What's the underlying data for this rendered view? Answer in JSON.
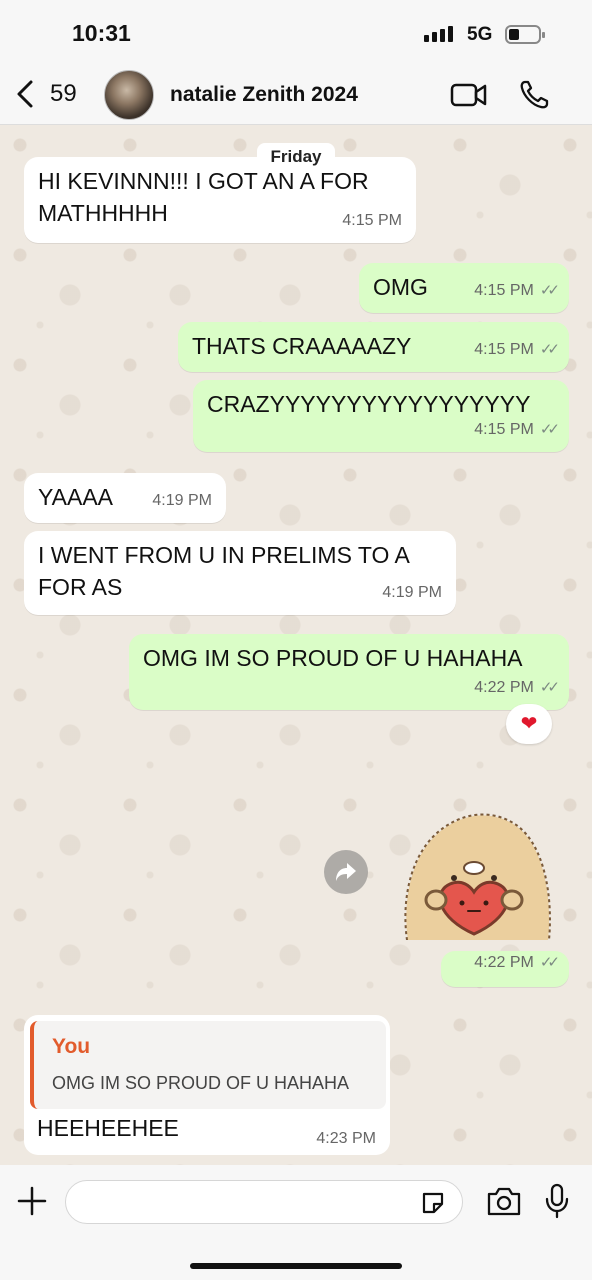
{
  "status": {
    "time": "10:31",
    "network": "5G"
  },
  "header": {
    "back_count": "59",
    "contact_name": "natalie Zenith 2024"
  },
  "date_label": "Friday",
  "messages": [
    {
      "text": "HI KEVINNN!!! I GOT AN A FOR MATHHHHH",
      "time": "4:15 PM"
    },
    {
      "text": "OMG",
      "time": "4:15 PM"
    },
    {
      "text": "THATS CRAAAAAZY",
      "time": "4:15 PM"
    },
    {
      "text": "CRAZYYYYYYYYYYYYYYYYY",
      "time": "4:15 PM"
    },
    {
      "text": "YAAAA",
      "time": "4:19 PM"
    },
    {
      "text": "I WENT FROM U IN PRELIMS TO A FOR AS",
      "time": "4:19 PM"
    },
    {
      "text": "OMG IM SO PROUD OF U HAHAHA",
      "time": "4:22 PM",
      "reaction": "❤"
    },
    {
      "sticker": true,
      "time": "4:22 PM"
    },
    {
      "reply_author": "You",
      "reply_text": "OMG IM SO PROUD OF U HAHAHA",
      "text": "HEEHEEHEE",
      "time": "4:23 PM"
    }
  ],
  "colors": {
    "outgoing": "#dafdc7",
    "incoming": "#ffffff",
    "reply_accent": "#e25b2c"
  }
}
